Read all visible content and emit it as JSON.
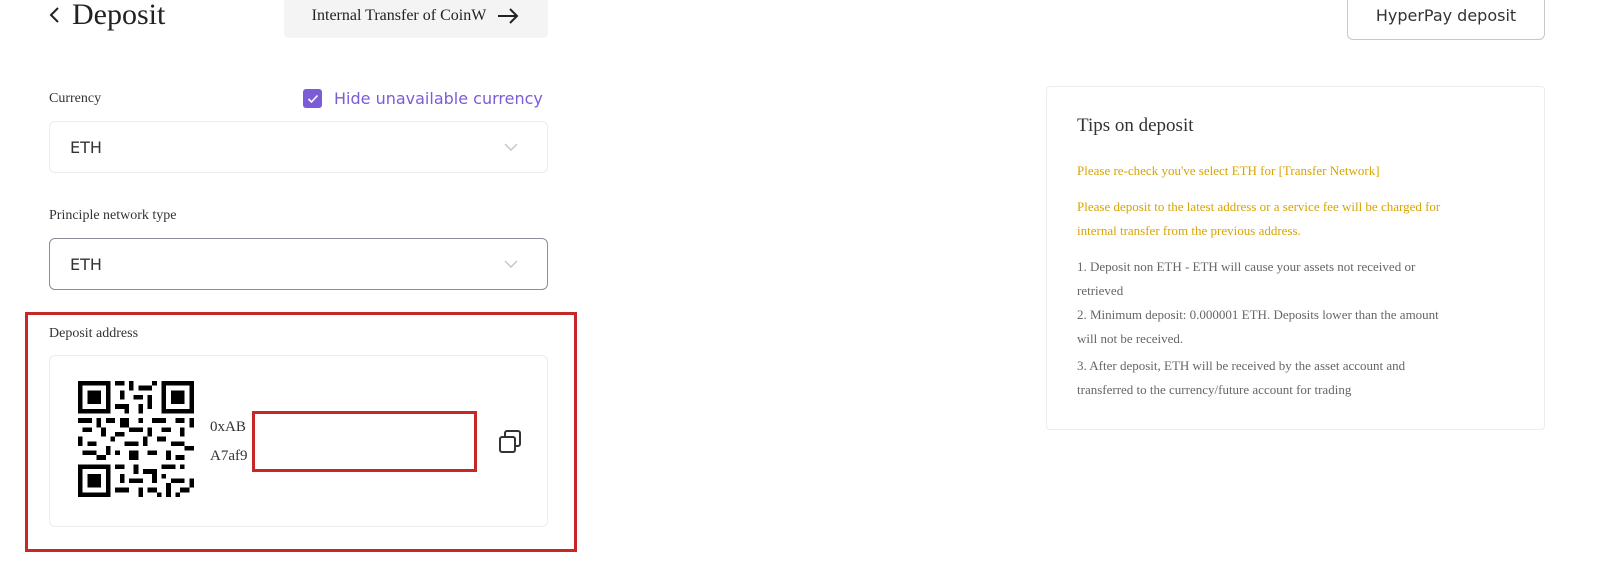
{
  "header": {
    "title": "Deposit",
    "internal_transfer_label": "Internal Transfer of CoinW",
    "hyperpay_label": "HyperPay deposit"
  },
  "form": {
    "currency_label": "Currency",
    "hide_unavailable_label": "Hide unavailable currency",
    "hide_unavailable_checked": true,
    "currency_value": "ETH",
    "network_label": "Principle network type",
    "network_value": "ETH"
  },
  "deposit": {
    "label": "Deposit address",
    "address_line1": "0xAB",
    "address_line2": "A7af9"
  },
  "tips": {
    "title": "Tips on deposit",
    "warning1": "Please re-check you've select ETH for [Transfer Network]",
    "warning2_line1": "Please deposit to the latest address or a service fee will be charged for",
    "warning2_line2": "internal transfer from the previous address.",
    "note1_line1": "1. Deposit non ETH - ETH will cause your assets not received or",
    "note1_line2": "retrieved",
    "note2_line1": "2. Minimum deposit: 0.000001 ETH. Deposits lower than the amount",
    "note2_line2": "will not be received.",
    "note3_line1": "3. After deposit, ETH will be received by the asset account and",
    "note3_line2": "transferred to the currency/future account for trading"
  },
  "colors": {
    "accent": "#7b5cd6",
    "warning": "#d8a400",
    "highlight": "#c62828"
  }
}
